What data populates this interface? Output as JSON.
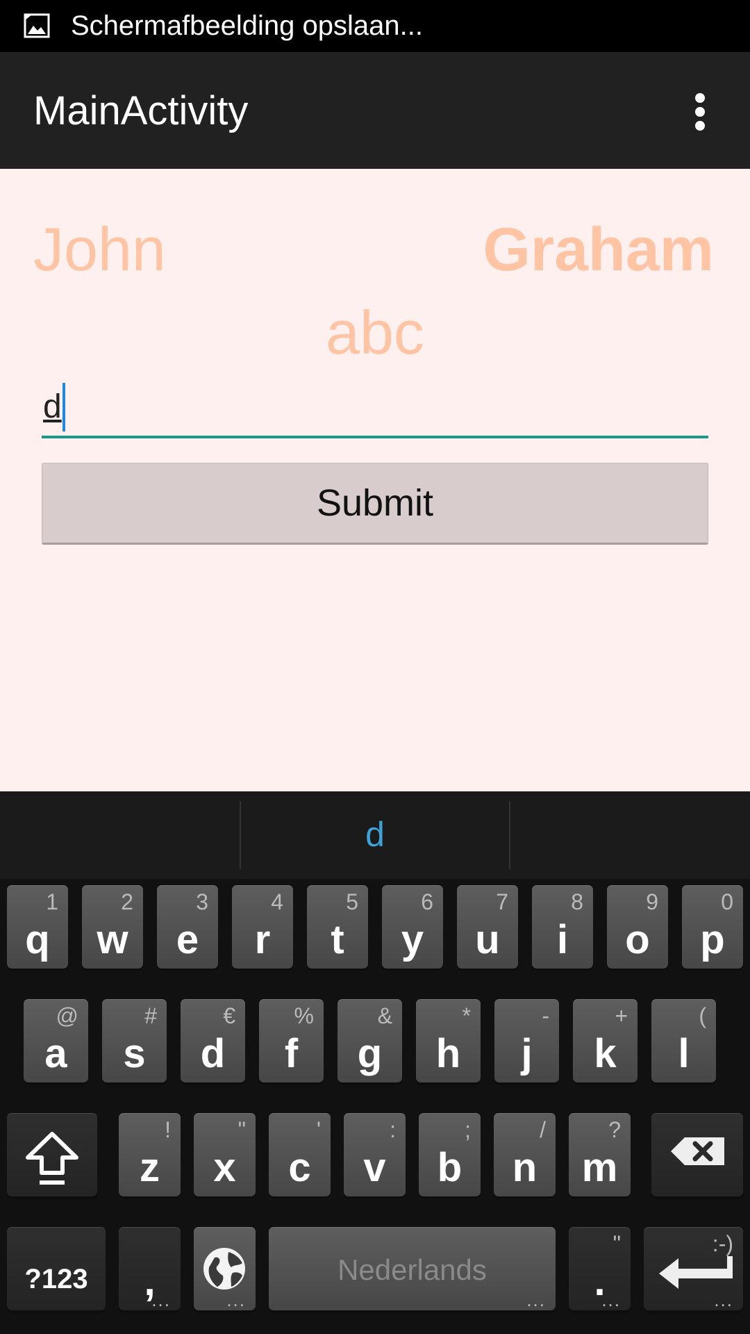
{
  "status_bar": {
    "notification_icon": "image-icon",
    "text": "Schermafbeelding opslaan..."
  },
  "action_bar": {
    "title": "MainActivity",
    "overflow_icon": "overflow-menu-icon"
  },
  "content": {
    "first_name": "John",
    "last_name": "Graham",
    "label": "abc",
    "input_value": "d",
    "submit_label": "Submit"
  },
  "keyboard": {
    "suggestion": "d",
    "row1": [
      {
        "label": "q",
        "hint": "1"
      },
      {
        "label": "w",
        "hint": "2"
      },
      {
        "label": "e",
        "hint": "3"
      },
      {
        "label": "r",
        "hint": "4"
      },
      {
        "label": "t",
        "hint": "5"
      },
      {
        "label": "y",
        "hint": "6"
      },
      {
        "label": "u",
        "hint": "7"
      },
      {
        "label": "i",
        "hint": "8"
      },
      {
        "label": "o",
        "hint": "9"
      },
      {
        "label": "p",
        "hint": "0"
      }
    ],
    "row2": [
      {
        "label": "a",
        "hint": "@"
      },
      {
        "label": "s",
        "hint": "#"
      },
      {
        "label": "d",
        "hint": "€"
      },
      {
        "label": "f",
        "hint": "%"
      },
      {
        "label": "g",
        "hint": "&"
      },
      {
        "label": "h",
        "hint": "*"
      },
      {
        "label": "j",
        "hint": "-"
      },
      {
        "label": "k",
        "hint": "+"
      },
      {
        "label": "l",
        "hint": "("
      }
    ],
    "row3": [
      {
        "label": "z",
        "hint": "!"
      },
      {
        "label": "x",
        "hint": "\""
      },
      {
        "label": "c",
        "hint": "'"
      },
      {
        "label": "v",
        "hint": ":"
      },
      {
        "label": "b",
        "hint": ";"
      },
      {
        "label": "n",
        "hint": "/"
      },
      {
        "label": "m",
        "hint": "?"
      }
    ],
    "symbols_label": "?123",
    "comma_label": ",",
    "space_label": "Nederlands",
    "period_label": ".",
    "period_hint": "\"",
    "enter_hint": ":-)",
    "shift_icon": "shift-icon",
    "backspace_icon": "backspace-icon",
    "globe_icon": "globe-icon",
    "enter_icon": "enter-icon"
  }
}
